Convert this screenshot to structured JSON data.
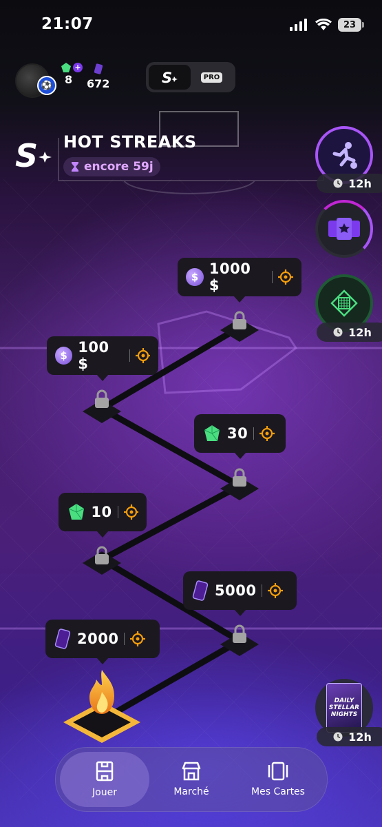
{
  "status_bar": {
    "time": "21:07",
    "battery": "23"
  },
  "header": {
    "gems_count": "8",
    "tickets_count": "672",
    "mode_toggle": {
      "pro_label": "PRO"
    }
  },
  "event": {
    "title": "HOT STREAKS",
    "timer": "encore 59j"
  },
  "side_panel": {
    "timer_1": "12h",
    "timer_3": "12h"
  },
  "rewards": [
    {
      "value": "1000 $",
      "icon": "coin-icon"
    },
    {
      "value": "100 $",
      "icon": "coin-icon"
    },
    {
      "value": "30",
      "icon": "gem-icon"
    },
    {
      "value": "10",
      "icon": "gem-icon"
    },
    {
      "value": "5000",
      "icon": "ticket-icon"
    },
    {
      "value": "2000",
      "icon": "ticket-icon"
    }
  ],
  "pack": {
    "label": "DAILY STELLAR NIGHTS",
    "timer": "12h"
  },
  "bottom_nav": [
    {
      "label": "Jouer",
      "active": true
    },
    {
      "label": "Marché",
      "active": false
    },
    {
      "label": "Mes Cartes",
      "active": false
    }
  ],
  "colors": {
    "accent": "#a855f7",
    "target": "#f59e0b",
    "gem": "#4ade80",
    "flame": "#f5a623"
  }
}
